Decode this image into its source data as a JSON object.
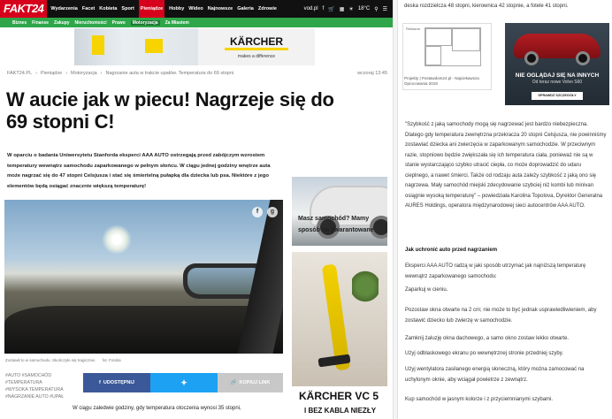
{
  "header": {
    "logo": "FAKT24",
    "nav": [
      "Wydarzenia",
      "Facet",
      "Kobieta",
      "Sport",
      "Pieniądze",
      "Hobby",
      "Wideo",
      "Najnowsze",
      "Galeria",
      "Zdrowie"
    ],
    "nav_active": "Pieniądze",
    "vod_label": "vod.pl",
    "weather_label": "18°C"
  },
  "subnav": {
    "items": [
      "Biznes",
      "Finanse",
      "Zakupy",
      "Nieruchomości",
      "Prawo",
      "Motoryzacja",
      "Za Miastem"
    ],
    "active": "Motoryzacja"
  },
  "ad_top": {
    "brand": "KÄRCHER",
    "tagline": "makes a difference"
  },
  "breadcrumb": {
    "items": [
      "FAKT24.PL",
      "Pieniądze",
      "Motoryzacja",
      "Nagrzanie auta w trakcie upałów. Temperatura do 69 stopni"
    ],
    "separator": "›",
    "time": "wczoraj 13:45"
  },
  "article": {
    "title": "W aucie jak w piecu! Nagrzeje się do 69 stopni C!",
    "lead": "W oparciu o badania Uniwersytetu Stanforda eksperci AAA AUTO ostrzegają przed zabójczym wzrostem temperatury wewnątrz samochodu zaparkowanego w pełnym słońcu. W ciągu jednej godziny wnętrze auta może nagrzać się do 47 stopni Celsjusza i stać się śmiertelną pułapką dla dziecka lub psa. Niektóre z jego elementów będą osiągać znacznie większą temperaturę!",
    "photo_caption": "Zostawił to w samochodu. Skończyło się tragicznie.",
    "photo_credit": "fot. Fotolia",
    "tags": [
      "#AUTO",
      "#SAMOCHÓD",
      "#TEMPERATURA",
      "#WYSOKA TEMPERATURA",
      "#NAGRZANIE AUTO",
      "#UPAŁ"
    ],
    "share_fb": "UDOSTĘPNIJ",
    "share_tw": "",
    "share_link": "KOPIUJ LINK",
    "body_start": "W ciągu zaledwie godziny, gdy temperatura otoczenia wynosi 35 stopni,"
  },
  "side_ads": {
    "car_promo": "Masz samochód? Mamy sposób na gwarantowane",
    "karcher_title": "KÄRCHER VC 5",
    "karcher_sub": "I BEZ KABLA NIEZŁY"
  },
  "right_column": {
    "top_text": "deska rozdzielcza 48 stopni, kierownica 42 stopnie, a fotele 41 stopni.",
    "plan_ad_label": "Reklama",
    "plan_ad_text": "Projekty | Postawdom24.pl - Najciekawsza Oprocowania 2019",
    "volvo_headline": "NIE OGLĄDAJ SIĘ NA INNYCH",
    "volvo_sub": "Od teraz nowe Volvo S60",
    "volvo_button": "SPRAWDŹ SZCZEGÓŁY",
    "quote": "\"Szybkość z jaką samochody mogą się nagrzewać jest bardzo niebezpieczna. Dlatego gdy temperatura zewnętrzna przekracza 20 stopni Celsjusza, nie powinniśmy zostawiać dziecka ani zwierzęcia w zaparkowanym samochodzie. W przeciwnym razie, stopniowo będzie zwiększała się ich temperatura ciała, ponieważ nie są w stanie wystarczająco szybko utracić ciepła, co może doprowadzić do udaru cieplnego, a nawet śmierci. Także od rodzaju auta zależy szybkość z jaką ono się nagrzewa. Mały samochód miejski zdecydowanie szybciej niż kombi lub minivan osiągnie wysoką temperaturę\" – powiedziała Karolina Topolova, Dyrektor Generalna AURES Holdings, operatora międzynarodowej sieci autocentrów AAA AUTO.",
    "heading": "Jak uchronić auto przed nagrzaniem",
    "intro": "Eksperci AAA AUTO radzą w jaki sposób utrzymać jak najniższą temperaturę wewnątrz zaparkowanego samochodu:",
    "tips": [
      "Zaparkuj w cieniu.",
      "Pozostaw okna otwarte na 2 cm; nie może to być jednak usprawiedliwieniem, aby zostawić dziecko lub zwierzę w samochodzie.",
      "Zamknij żaluzję okna dachowego, a samo okno zostaw lekko otwarte.",
      "Użyj odblaskowego ekranu po wewnętrznej stronie przedniej szyby.",
      "Użyj wentylatora zasilanego energią słoneczną, który można zamocować na uchylonym oknie, aby wciągał powietrze z zewnątrz.",
      "Kup samochód w jasnym kolorze i z przyciemnianymi szybami."
    ]
  },
  "colors": {
    "brand_red": "#d6001c",
    "subnav_green": "#2fa64a",
    "facebook": "#3b5998",
    "twitter": "#1da1f2"
  }
}
